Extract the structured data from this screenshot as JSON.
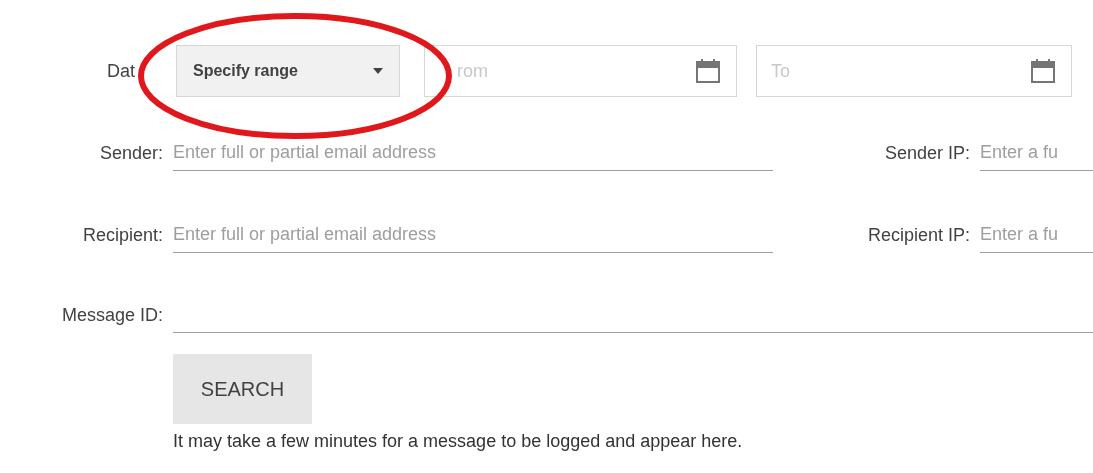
{
  "date": {
    "label": "Dat",
    "range_select": {
      "value": "Specify range"
    },
    "from": {
      "placeholder": "rom"
    },
    "to": {
      "placeholder": "To"
    }
  },
  "sender": {
    "label": "Sender:",
    "placeholder": "Enter full or partial email address"
  },
  "sender_ip": {
    "label": "Sender IP:",
    "placeholder": "Enter a fu"
  },
  "recipient": {
    "label": "Recipient:",
    "placeholder": "Enter full or partial email address"
  },
  "recipient_ip": {
    "label": "Recipient IP:",
    "placeholder": "Enter a fu"
  },
  "message_id": {
    "label": "Message ID:"
  },
  "search_button": "SEARCH",
  "note": "It may take a few minutes for a message to be logged and appear here.",
  "annotation": {
    "kind": "ellipse",
    "color": "#e0181b"
  }
}
